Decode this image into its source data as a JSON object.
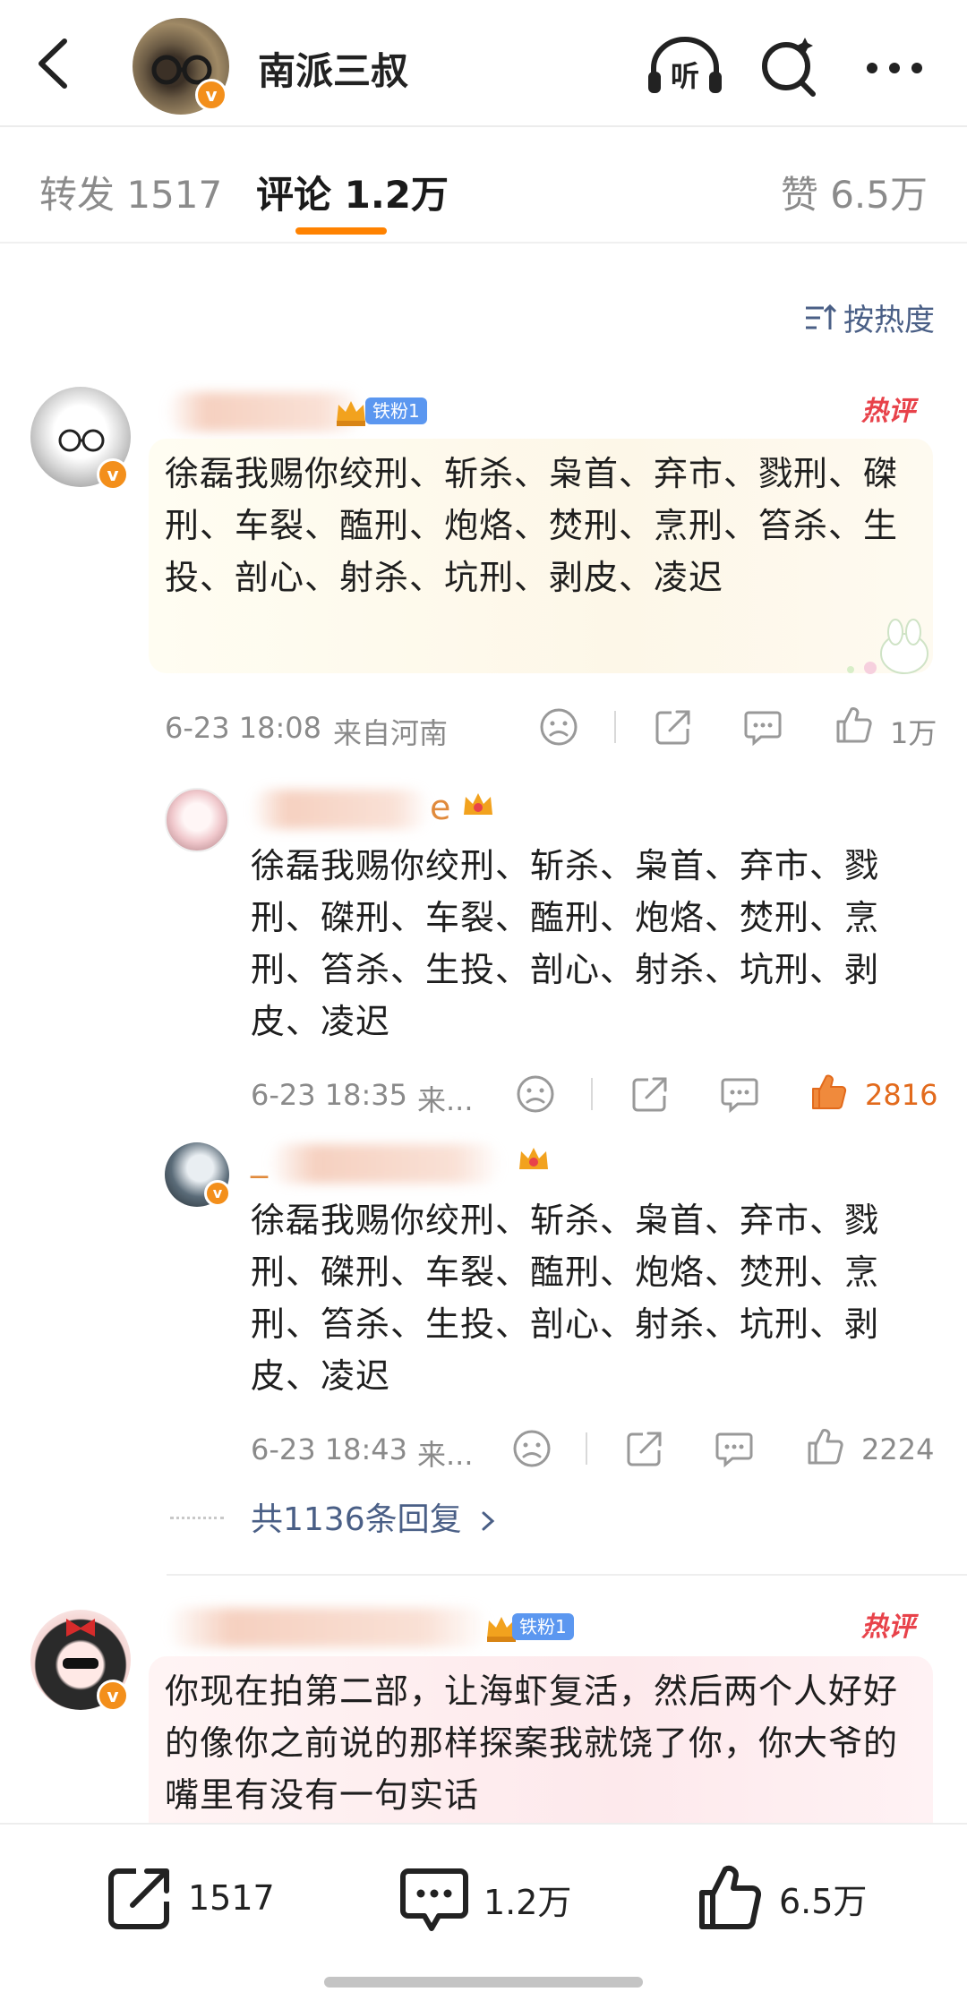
{
  "header": {
    "title": "南派三叔",
    "back_icon": "chevron-left-icon",
    "listen_label": "听",
    "search_icon": "search-icon",
    "more_icon": "more-icon"
  },
  "tabs": [
    {
      "label": "转发 1517"
    },
    {
      "label": "评论 1.2万"
    },
    {
      "label": "赞 6.5万"
    }
  ],
  "sort_label": "按热度",
  "comments": [
    {
      "fan_badge": "铁粉1",
      "hot_label": "热评",
      "text": "徐磊我赐你绞刑、斩杀、枭首、弃市、戮刑、磔刑、车裂、醢刑、炮烙、焚刑、烹刑、笞杀、生投、剖心、射杀、坑刑、剥皮、凌迟",
      "time": "6-23 18:08",
      "location": "来自河南",
      "likes": "1万"
    },
    {
      "fan_badge": "铁粉1",
      "hot_label": "热评",
      "text": "你现在拍第二部，让海虾复活，然后两个人好好的像你之前说的那样探案我就饶了你，你大爷的嘴里有没有一句实话"
    }
  ],
  "replies": [
    {
      "name_suffix": "e",
      "text": "徐磊我赐你绞刑、斩杀、枭首、弃市、戮刑、磔刑、车裂、醢刑、炮烙、焚刑、烹刑、笞杀、生投、剖心、射杀、坑刑、剥皮、凌迟",
      "time": "6-23 18:35",
      "location": "来...",
      "likes": "2816"
    },
    {
      "name_prefix": "_",
      "text": "徐磊我赐你绞刑、斩杀、枭首、弃市、戮刑、磔刑、车裂、醢刑、炮烙、焚刑、烹刑、笞杀、生投、剖心、射杀、坑刑、剥皮、凌迟",
      "time": "6-23 18:43",
      "location": "来...",
      "likes": "2224"
    }
  ],
  "more_replies_label": "共1136条回复",
  "bottom_bar": {
    "repost_count": "1517",
    "comment_count": "1.2万",
    "like_count": "6.5万"
  },
  "colors": {
    "accent": "#ff8200",
    "link": "#4a5f86",
    "hot": "#e8424a",
    "liked": "#e26a1c"
  }
}
